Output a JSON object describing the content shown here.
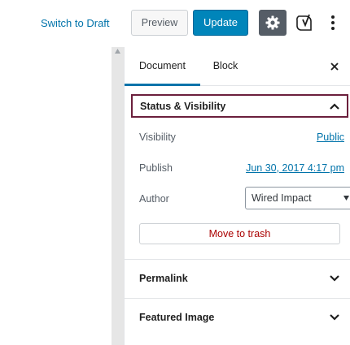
{
  "toolbar": {
    "switch_to_draft": "Switch to Draft",
    "preview": "Preview",
    "update": "Update"
  },
  "tabs": {
    "document": "Document",
    "block": "Block"
  },
  "status_visibility": {
    "title": "Status & Visibility",
    "visibility_label": "Visibility",
    "visibility_value": "Public",
    "publish_label": "Publish",
    "publish_value": "Jun 30, 2017 4:17 pm",
    "author_label": "Author",
    "author_value": "Wired Impact",
    "trash": "Move to trash"
  },
  "sections": {
    "permalink": "Permalink",
    "featured_image": "Featured Image"
  },
  "colors": {
    "accent": "#0073aa",
    "update_button": "#0085ba",
    "settings_button": "#555d66",
    "focus_outline": "#6b1f3c",
    "trash_text": "#aa0000"
  },
  "icons": [
    "gear-icon",
    "yoast-icon",
    "more-vertical-icon",
    "close-icon",
    "chevron-up-icon",
    "chevron-down-icon"
  ]
}
